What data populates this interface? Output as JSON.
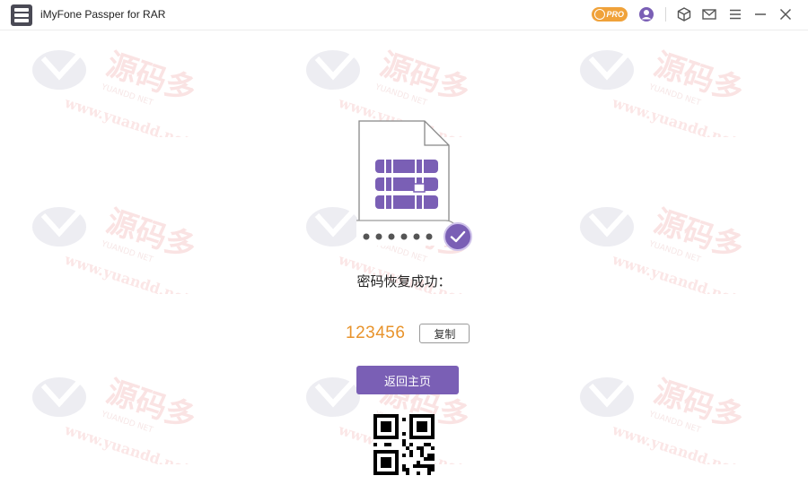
{
  "titlebar": {
    "app_title": "iMyFone Passper for RAR",
    "pro_label": "PRO",
    "icons": [
      "user-icon",
      "cube-icon",
      "mail-icon",
      "menu-icon",
      "minimize-icon",
      "close-icon"
    ]
  },
  "main": {
    "result_label": "密码恢复成功：",
    "password": "123456",
    "copy_label": "复制",
    "home_label": "返回主页"
  },
  "watermark": {
    "brand": "源码多",
    "site": "www.yuandd.net",
    "sub": "YUANDD NET"
  },
  "colors": {
    "accent": "#7a5fb5",
    "password": "#e8932b",
    "pro": "#f0a23a"
  }
}
